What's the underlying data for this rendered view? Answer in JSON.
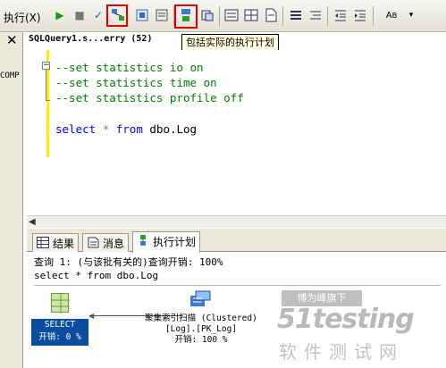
{
  "toolbar": {
    "execute_label": "执行(X)",
    "tooltip": "包括实际的执行计划"
  },
  "sidebar": {
    "close": "✕",
    "truncated_label": "COMP"
  },
  "document_tab": {
    "title": "SQLQuery1.s...erry (52)"
  },
  "editor": {
    "lines": [
      "--set statistics io on",
      "--set statistics time on",
      "--set statistics profile off"
    ],
    "select_kw": "select",
    "star": "*",
    "from_kw": "from",
    "table": "dbo.Log"
  },
  "results_tabs": {
    "results": "结果",
    "messages": "消息",
    "plan": "执行计划"
  },
  "plan": {
    "query_header": "查询 1: (与该批有关的)查询开销: 100%",
    "query_text": "select * from dbo.Log",
    "select_node": {
      "name": "SELECT",
      "cost": "开销: 0 %"
    },
    "scan_node": {
      "text": "聚集索引扫描 (Clustered)\n[Log].[PK_Log]\n开销: 100 %"
    }
  },
  "watermark": {
    "top": "博为峰旗下",
    "logo": "51testing",
    "sub": "软件测试网"
  },
  "colors": {
    "highlight": "#e00000",
    "comment": "#008000",
    "keyword": "#0000ff",
    "select_node_bg": "#0a4c9f"
  }
}
